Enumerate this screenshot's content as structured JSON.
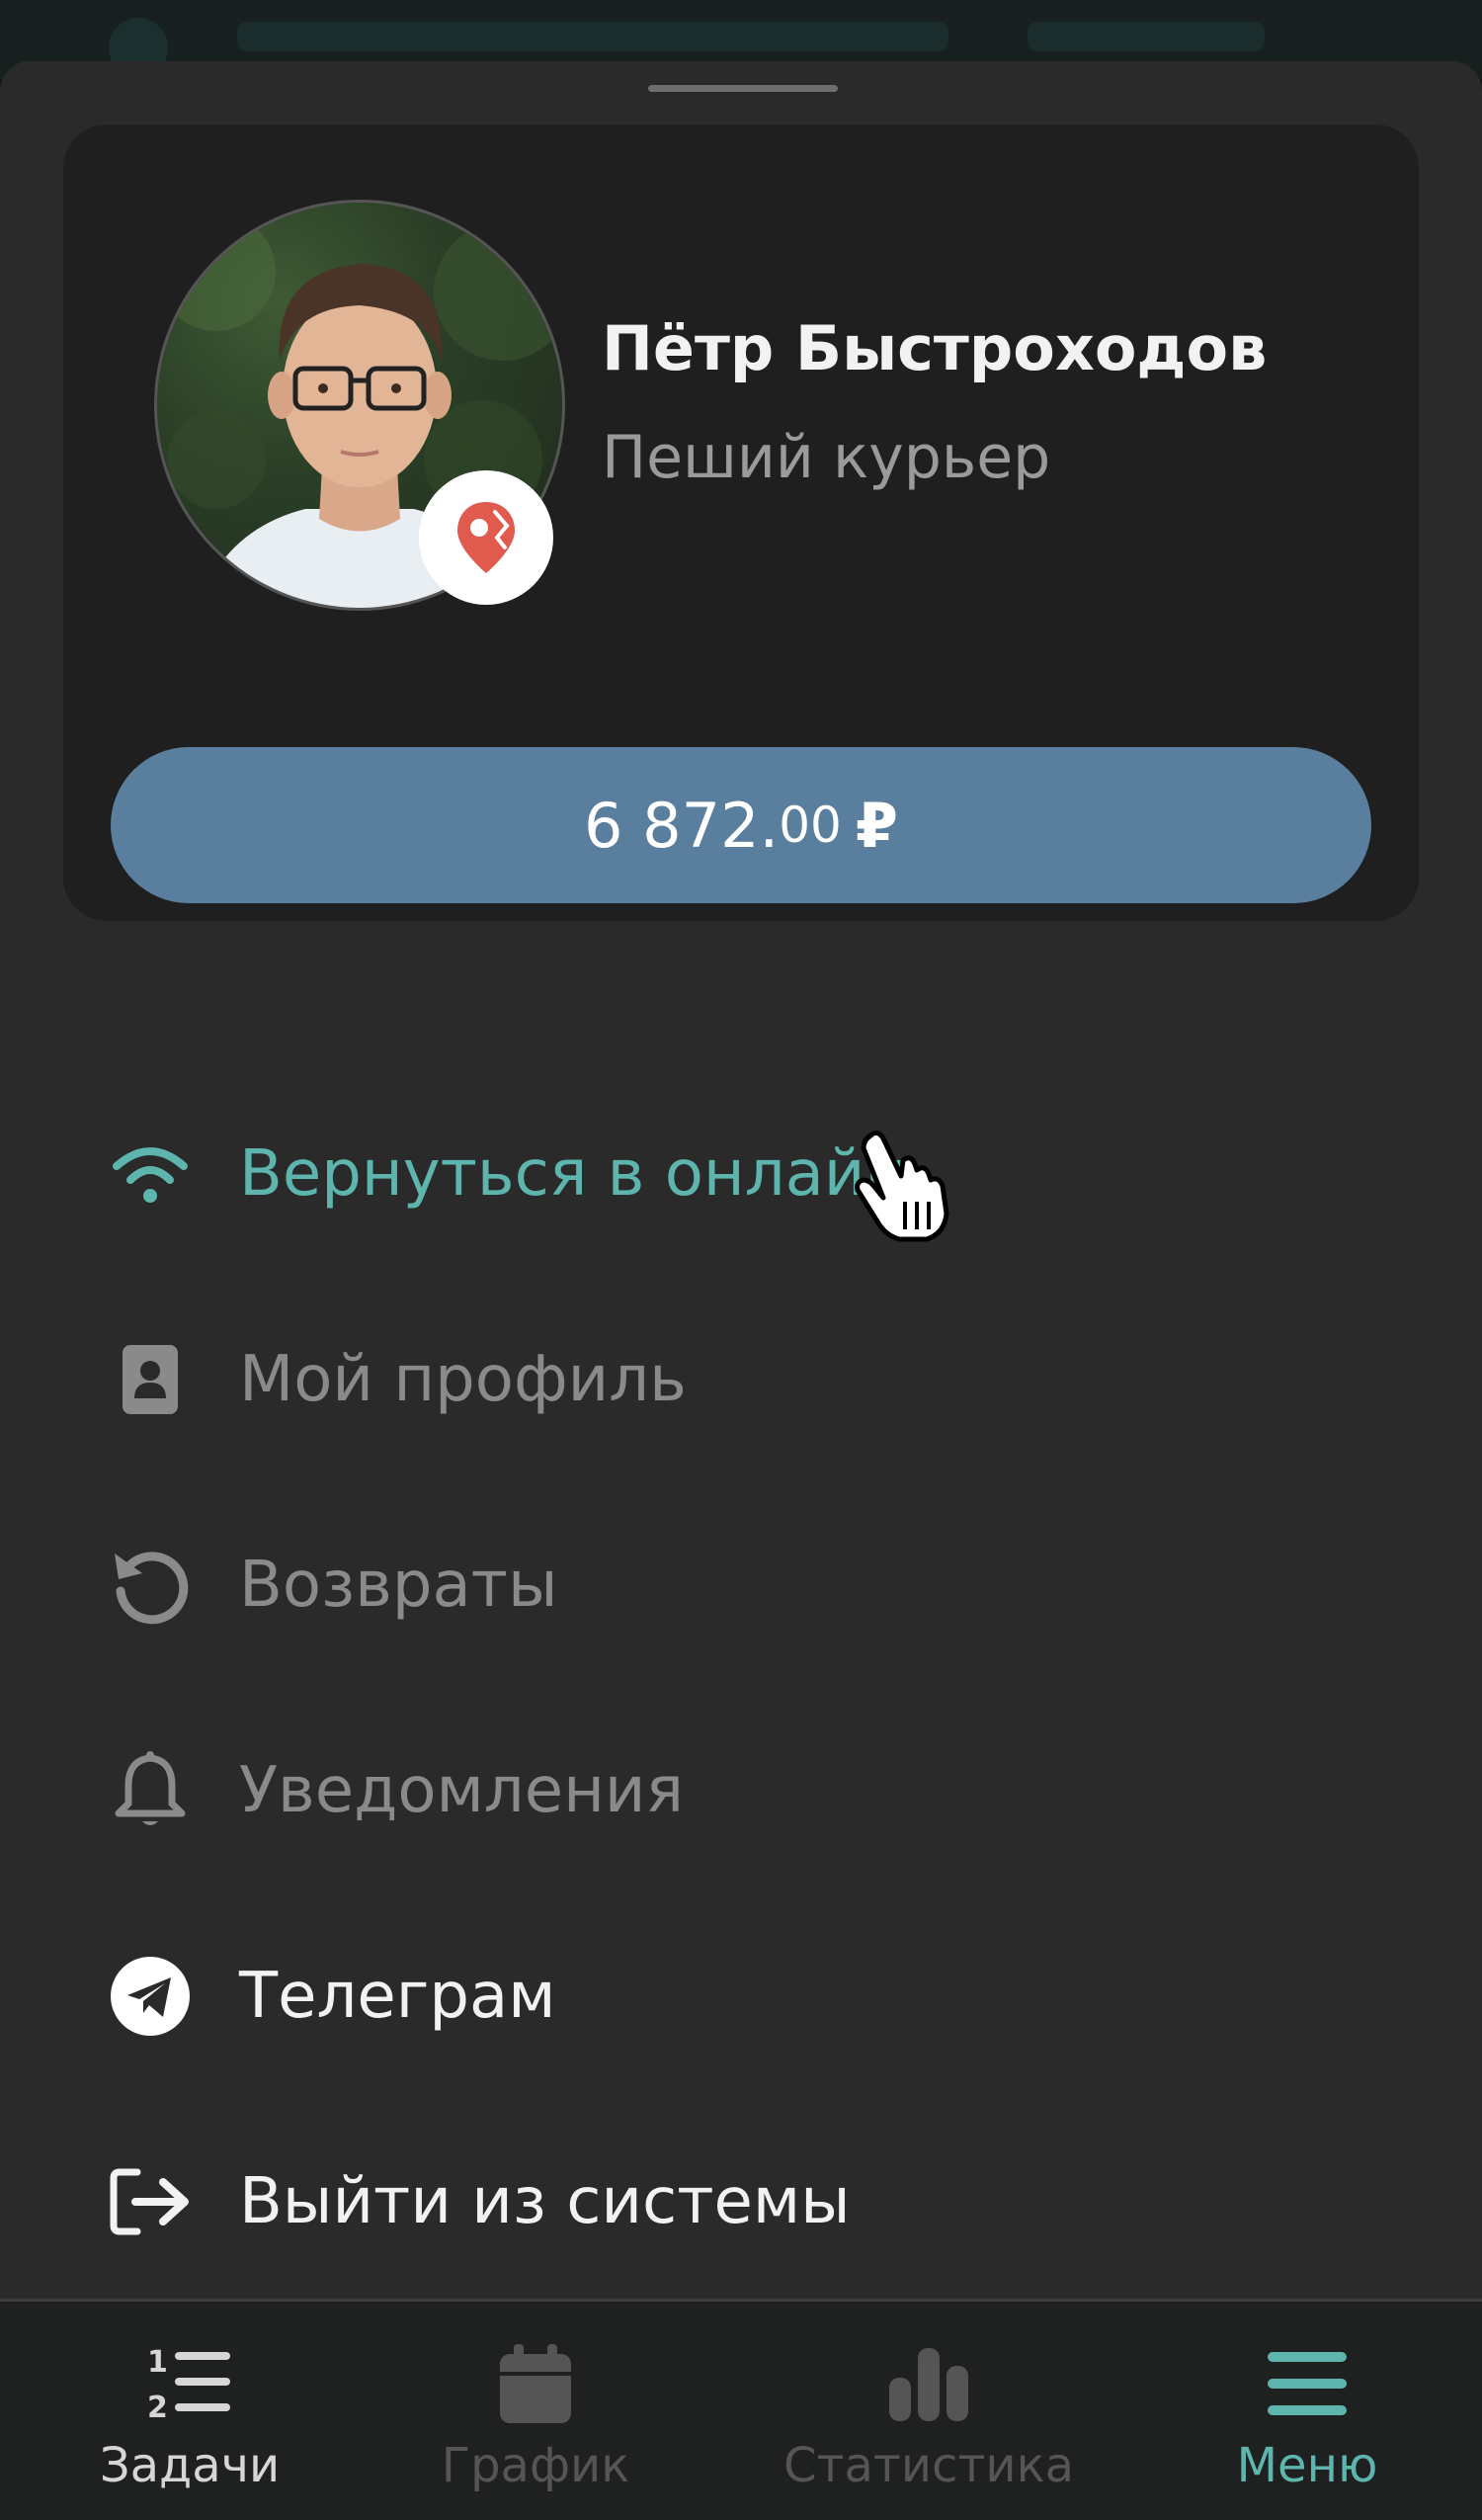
{
  "profile": {
    "name": "Пётр Быстроходов",
    "role": "Пеший курьер",
    "balance_main": "6 872.",
    "balance_cents": "00",
    "balance_currency": "₽"
  },
  "menu": {
    "items": [
      {
        "label": "Вернуться в онлайн",
        "icon": "wifi-icon",
        "color": "#5eb5ad"
      },
      {
        "label": "Мой профиль",
        "icon": "contact-card-icon",
        "color": "#8a8a8a"
      },
      {
        "label": "Возвраты",
        "icon": "undo-arrow-icon",
        "color": "#8a8a8a"
      },
      {
        "label": "Уведомления",
        "icon": "bell-icon",
        "color": "#8a8a8a"
      },
      {
        "label": "Телеграм",
        "icon": "telegram-icon",
        "color": "#f2f2f2"
      },
      {
        "label": "Выйти из системы",
        "icon": "logout-icon",
        "color": "#f2f2f2"
      }
    ]
  },
  "tabbar": {
    "tabs": [
      {
        "label": "Задачи",
        "icon": "numbered-list-icon",
        "state": "normal"
      },
      {
        "label": "График",
        "icon": "calendar-icon",
        "state": "disabled"
      },
      {
        "label": "Статистика",
        "icon": "bar-chart-icon",
        "state": "disabled"
      },
      {
        "label": "Меню",
        "icon": "hamburger-menu-icon",
        "state": "active"
      }
    ]
  },
  "colors": {
    "accent": "#5eb5ad",
    "balance_button": "#5a7f9e",
    "sheet_background": "#2a2a2b",
    "card_background": "#1f1f1f",
    "badge_marker": "#e05a4e"
  }
}
